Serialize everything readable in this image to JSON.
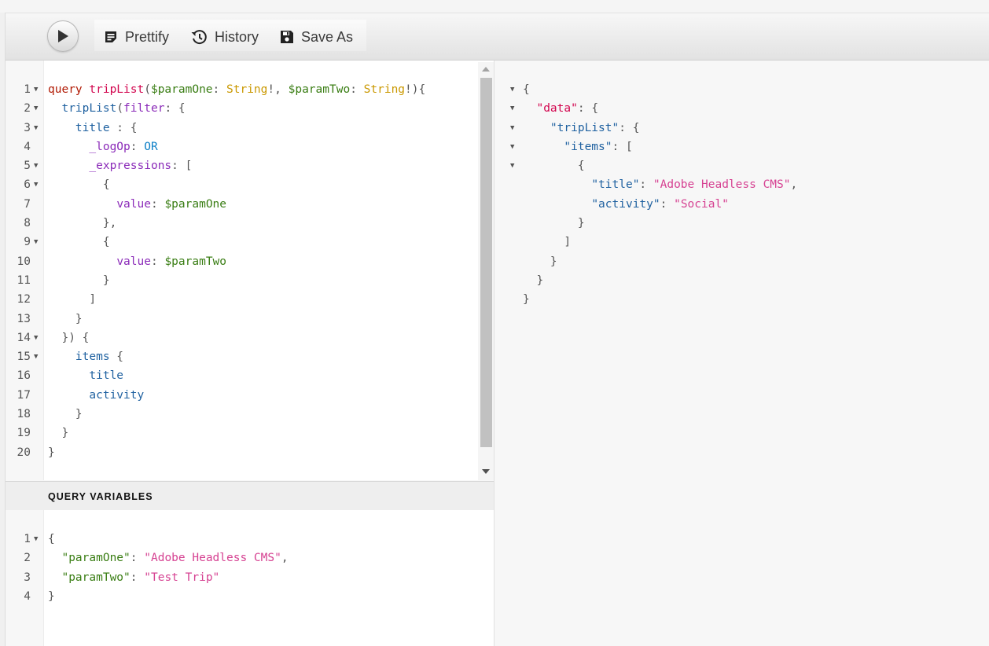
{
  "toolbar": {
    "prettify_label": "Prettify",
    "history_label": "History",
    "save_as_label": "Save As"
  },
  "query": {
    "lines": [
      {
        "num": "1",
        "fold": true,
        "tokens": [
          [
            "query",
            "kw"
          ],
          [
            " ",
            ""
          ],
          [
            "tripList",
            "def"
          ],
          [
            "(",
            "punc"
          ],
          [
            "$paramOne",
            "var"
          ],
          [
            ": ",
            "punc"
          ],
          [
            "String",
            "type"
          ],
          [
            "!, ",
            "punc"
          ],
          [
            "$paramTwo",
            "var"
          ],
          [
            ": ",
            "punc"
          ],
          [
            "String",
            "type"
          ],
          [
            "!){",
            "punc"
          ]
        ]
      },
      {
        "num": "2",
        "fold": true,
        "tokens": [
          [
            "  ",
            ""
          ],
          [
            "tripList",
            "prop"
          ],
          [
            "(",
            "punc"
          ],
          [
            "filter",
            "attr"
          ],
          [
            ": {",
            "punc"
          ]
        ]
      },
      {
        "num": "3",
        "fold": true,
        "tokens": [
          [
            "    ",
            ""
          ],
          [
            "title",
            "prop"
          ],
          [
            " : {",
            "punc"
          ]
        ]
      },
      {
        "num": "4",
        "fold": false,
        "tokens": [
          [
            "      ",
            ""
          ],
          [
            "_logOp",
            "attr"
          ],
          [
            ": ",
            "punc"
          ],
          [
            "OR",
            "enum"
          ]
        ]
      },
      {
        "num": "5",
        "fold": true,
        "tokens": [
          [
            "      ",
            ""
          ],
          [
            "_expressions",
            "attr"
          ],
          [
            ": [",
            "punc"
          ]
        ]
      },
      {
        "num": "6",
        "fold": true,
        "tokens": [
          [
            "        {",
            "punc"
          ]
        ]
      },
      {
        "num": "7",
        "fold": false,
        "tokens": [
          [
            "          ",
            ""
          ],
          [
            "value",
            "attr"
          ],
          [
            ": ",
            "punc"
          ],
          [
            "$paramOne",
            "var"
          ]
        ]
      },
      {
        "num": "8",
        "fold": false,
        "tokens": [
          [
            "        },",
            "punc"
          ]
        ]
      },
      {
        "num": "9",
        "fold": true,
        "tokens": [
          [
            "        {",
            "punc"
          ]
        ]
      },
      {
        "num": "10",
        "fold": false,
        "tokens": [
          [
            "          ",
            ""
          ],
          [
            "value",
            "attr"
          ],
          [
            ": ",
            "punc"
          ],
          [
            "$paramTwo",
            "var"
          ]
        ]
      },
      {
        "num": "11",
        "fold": false,
        "tokens": [
          [
            "        }",
            "punc"
          ]
        ]
      },
      {
        "num": "12",
        "fold": false,
        "tokens": [
          [
            "      ]",
            "punc"
          ]
        ]
      },
      {
        "num": "13",
        "fold": false,
        "tokens": [
          [
            "    }",
            "punc"
          ]
        ]
      },
      {
        "num": "14",
        "fold": true,
        "tokens": [
          [
            "  }) {",
            "punc"
          ]
        ]
      },
      {
        "num": "15",
        "fold": true,
        "tokens": [
          [
            "    ",
            ""
          ],
          [
            "items",
            "prop"
          ],
          [
            " {",
            "punc"
          ]
        ]
      },
      {
        "num": "16",
        "fold": false,
        "tokens": [
          [
            "      ",
            ""
          ],
          [
            "title",
            "prop"
          ]
        ]
      },
      {
        "num": "17",
        "fold": false,
        "tokens": [
          [
            "      ",
            ""
          ],
          [
            "activity",
            "prop"
          ]
        ]
      },
      {
        "num": "18",
        "fold": false,
        "tokens": [
          [
            "    }",
            "punc"
          ]
        ]
      },
      {
        "num": "19",
        "fold": false,
        "tokens": [
          [
            "  }",
            "punc"
          ]
        ]
      },
      {
        "num": "20",
        "fold": false,
        "tokens": [
          [
            "}",
            "punc"
          ]
        ]
      }
    ]
  },
  "variables": {
    "title": "QUERY VARIABLES",
    "lines": [
      {
        "num": "1",
        "fold": true,
        "tokens": [
          [
            "{",
            "punc"
          ]
        ]
      },
      {
        "num": "2",
        "fold": false,
        "tokens": [
          [
            "  ",
            ""
          ],
          [
            "\"paramOne\"",
            "var"
          ],
          [
            ": ",
            "punc"
          ],
          [
            "\"Adobe Headless CMS\"",
            "str"
          ],
          [
            ",",
            "punc"
          ]
        ]
      },
      {
        "num": "3",
        "fold": false,
        "tokens": [
          [
            "  ",
            ""
          ],
          [
            "\"paramTwo\"",
            "var"
          ],
          [
            ": ",
            "punc"
          ],
          [
            "\"Test Trip\"",
            "str"
          ]
        ]
      },
      {
        "num": "4",
        "fold": false,
        "tokens": [
          [
            "}",
            "punc"
          ]
        ]
      }
    ]
  },
  "result": {
    "lines": [
      {
        "fold": true,
        "tokens": [
          [
            "{",
            "punc"
          ]
        ]
      },
      {
        "fold": true,
        "tokens": [
          [
            "  ",
            ""
          ],
          [
            "\"data\"",
            "def"
          ],
          [
            ": {",
            "punc"
          ]
        ]
      },
      {
        "fold": true,
        "tokens": [
          [
            "    ",
            ""
          ],
          [
            "\"tripList\"",
            "prop"
          ],
          [
            ": {",
            "punc"
          ]
        ]
      },
      {
        "fold": true,
        "tokens": [
          [
            "      ",
            ""
          ],
          [
            "\"items\"",
            "prop"
          ],
          [
            ": [",
            "punc"
          ]
        ]
      },
      {
        "fold": true,
        "tokens": [
          [
            "        {",
            "punc"
          ]
        ]
      },
      {
        "fold": false,
        "tokens": [
          [
            "          ",
            ""
          ],
          [
            "\"title\"",
            "prop"
          ],
          [
            ": ",
            "punc"
          ],
          [
            "\"Adobe Headless CMS\"",
            "str"
          ],
          [
            ",",
            "punc"
          ]
        ]
      },
      {
        "fold": false,
        "tokens": [
          [
            "          ",
            ""
          ],
          [
            "\"activity\"",
            "prop"
          ],
          [
            ": ",
            "punc"
          ],
          [
            "\"Social\"",
            "str"
          ]
        ]
      },
      {
        "fold": false,
        "tokens": [
          [
            "        }",
            "punc"
          ]
        ]
      },
      {
        "fold": false,
        "tokens": [
          [
            "      ]",
            "punc"
          ]
        ]
      },
      {
        "fold": false,
        "tokens": [
          [
            "    }",
            "punc"
          ]
        ]
      },
      {
        "fold": false,
        "tokens": [
          [
            "  }",
            "punc"
          ]
        ]
      },
      {
        "fold": false,
        "tokens": [
          [
            "}",
            "punc"
          ]
        ]
      }
    ]
  }
}
